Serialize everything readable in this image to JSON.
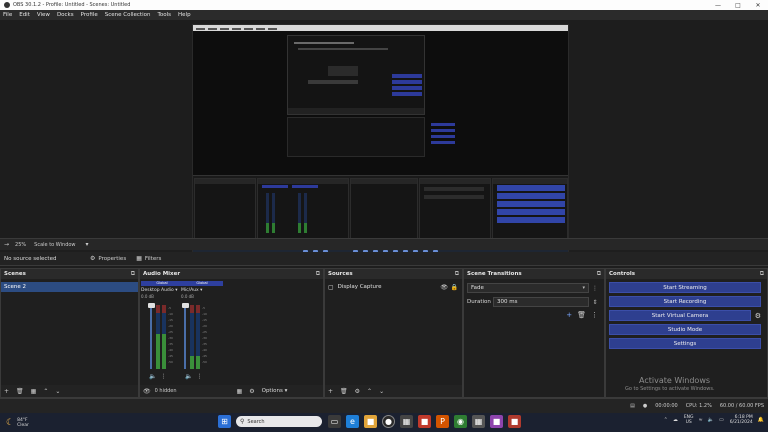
{
  "window": {
    "title": "OBS 30.1.2 - Profile: Untitled - Scenes: Untitled"
  },
  "menu": [
    "File",
    "Edit",
    "View",
    "Docks",
    "Profile",
    "Scene Collection",
    "Tools",
    "Help"
  ],
  "preview_toolbar": {
    "zoom": "25%",
    "scale_mode": "Scale to Window"
  },
  "source_toolbar": {
    "no_source": "No source selected",
    "properties": "Properties",
    "filters": "Filters"
  },
  "scenes": {
    "title": "Scenes",
    "items": [
      "Scene 2"
    ]
  },
  "mixer": {
    "title": "Audio Mixer",
    "channels": [
      {
        "name": "Desktop Audio",
        "badge": "Global",
        "db": "0.0 dB",
        "level": 0.55
      },
      {
        "name": "Mic/Aux",
        "badge": "Global",
        "db": "0.0 dB",
        "level": 0.2
      }
    ],
    "hidden": "0 hidden",
    "options": "Options"
  },
  "sources": {
    "title": "Sources",
    "items": [
      "Display Capture"
    ]
  },
  "transitions": {
    "title": "Scene Transitions",
    "selected": "Fade",
    "duration_label": "Duration",
    "duration_value": "300 ms"
  },
  "controls": {
    "title": "Controls",
    "start_streaming": "Start Streaming",
    "start_recording": "Start Recording",
    "start_virtual_camera": "Start Virtual Camera",
    "studio_mode": "Studio Mode",
    "settings": "Settings"
  },
  "watermark": {
    "line1": "Activate Windows",
    "line2": "Go to Settings to activate Windows."
  },
  "status": {
    "rec_time": "00:00:00",
    "cpu": "CPU: 1.2%",
    "fps": "60.00 / 60.00 FPS"
  },
  "taskbar": {
    "weather_temp": "84°F",
    "weather_desc": "Clear",
    "search": "Search",
    "lang1": "ENG",
    "lang2": "US",
    "time": "6:18 PM",
    "date": "6/21/2024"
  },
  "colors": {
    "accent_blue": "#2e3f8f",
    "scene_selected": "#2c4c82",
    "meter_green": "#3a8f3a"
  }
}
